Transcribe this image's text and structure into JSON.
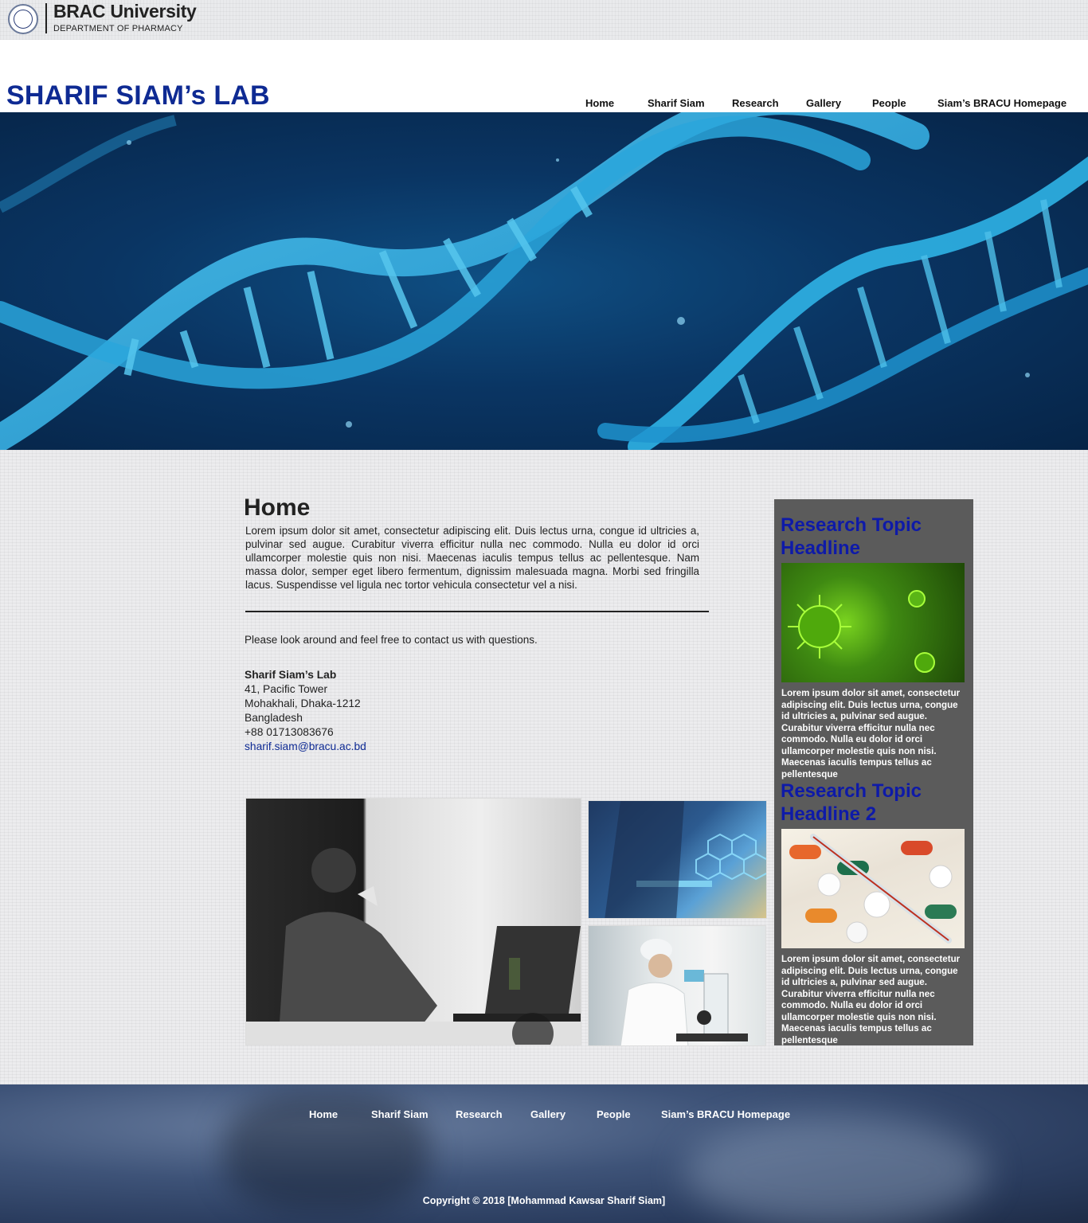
{
  "brand": {
    "university": "BRAC University",
    "department": "DEPARTMENT OF PHARMACY",
    "logo_icon": "university-seal-icon"
  },
  "header": {
    "lab_title": "SHARIF SIAM’s LAB"
  },
  "nav": {
    "items": [
      {
        "label": "Home"
      },
      {
        "label": "Sharif Siam"
      },
      {
        "label": "Research"
      },
      {
        "label": "Gallery"
      },
      {
        "label": "People"
      },
      {
        "label": "Siam’s BRACU Homepage"
      }
    ]
  },
  "main": {
    "heading": "Home",
    "intro": "Lorem ipsum dolor sit amet, consectetur adipiscing elit. Duis lectus urna, congue id ultricies a, pulvinar sed augue. Curabitur viverra efficitur nulla nec commodo. Nulla eu dolor id orci ullamcorper molestie quis non nisi. Maecenas iaculis tempus tellus ac pellentesque. Nam massa dolor, semper eget libero fermentum, dignissim malesuada magna. Morbi sed fringilla lacus. Suspendisse vel ligula nec tortor vehicula consectetur vel a nisi.",
    "invite": "Please look around and feel free to contact us with questions.",
    "address": {
      "lab_name": "Sharif Siam’s Lab",
      "line1": "41, Pacific Tower",
      "line2": "Mohakhali, Dhaka-1212",
      "line3": "Bangladesh",
      "phone": "+88 01713083676",
      "email": "sharif.siam@bracu.ac.bd"
    }
  },
  "sidebar": {
    "topics": [
      {
        "title": "Research Topic Headline",
        "text": "Lorem ipsum dolor sit amet, consectetur adipiscing elit. Duis lectus urna, congue id ultricies a, pulvinar sed augue. Curabitur viverra efficitur nulla nec commodo. Nulla eu dolor id orci ullamcorper molestie quis non nisi. Maecenas iaculis tempus tellus ac pellentesque"
      },
      {
        "title": "Research Topic Headline 2",
        "text": "Lorem ipsum dolor sit amet, consectetur adipiscing elit. Duis lectus urna, congue id ultricies a, pulvinar sed augue. Curabitur viverra efficitur nulla nec commodo. Nulla eu dolor id orci ullamcorper molestie quis non nisi. Maecenas iaculis tempus tellus ac pellentesque"
      }
    ]
  },
  "footer": {
    "copyright": "Copyright © 2018 [Mohammad Kawsar Sharif Siam]"
  },
  "colors": {
    "title_blue": "#0e2a93",
    "sidebar_bg": "#5b5b5b",
    "hero_blue": "#0a3563"
  }
}
